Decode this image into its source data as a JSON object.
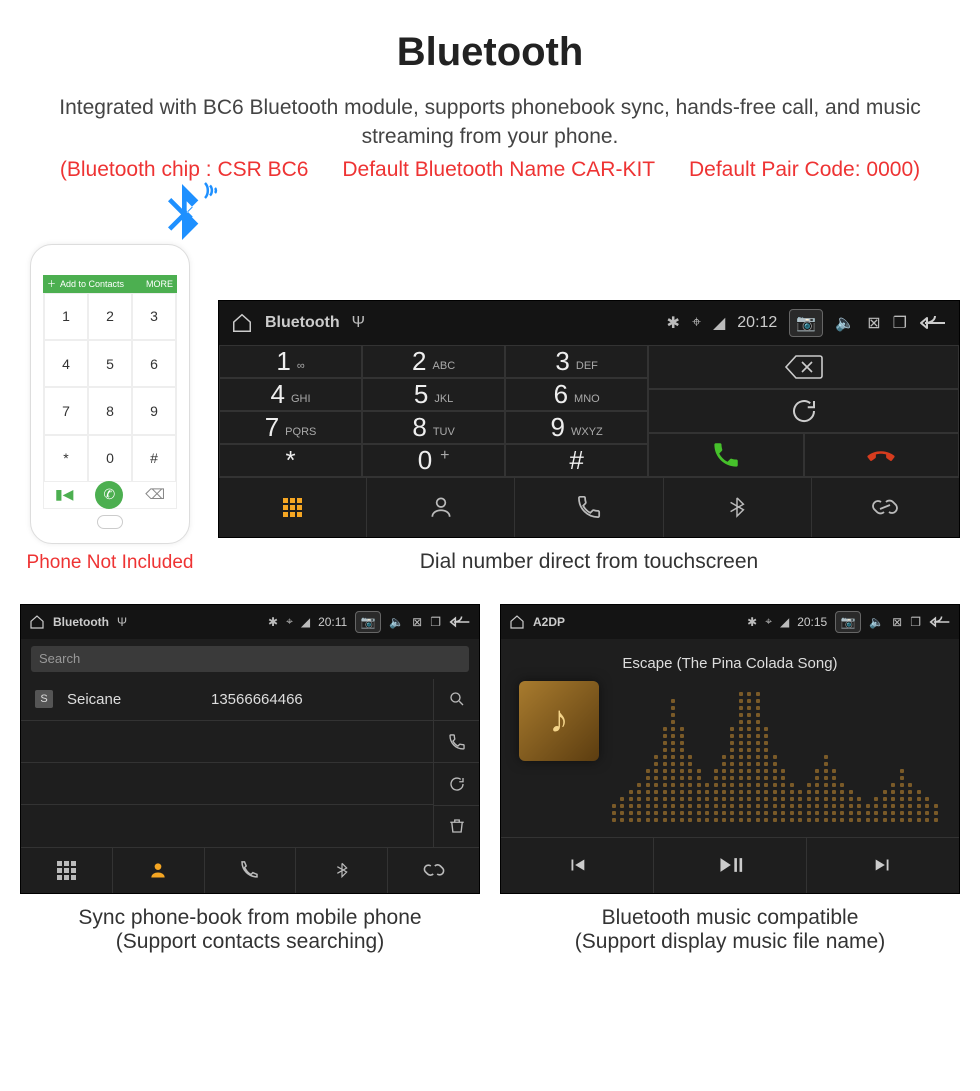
{
  "header": {
    "title": "Bluetooth",
    "description": "Integrated with BC6 Bluetooth module, supports phonebook sync, hands-free call, and music streaming from your phone.",
    "spec_chip": "(Bluetooth chip : CSR BC6",
    "spec_name": "Default Bluetooth Name CAR-KIT",
    "spec_code": "Default Pair Code: 0000)"
  },
  "phone": {
    "topbar_add": "Add to Contacts",
    "topbar_more": "MORE",
    "keys": [
      "1",
      "2",
      "3",
      "4",
      "5",
      "6",
      "7",
      "8",
      "9",
      "*",
      "0",
      "#"
    ],
    "caption": "Phone Not Included"
  },
  "dialer": {
    "statusbar": {
      "title": "Bluetooth",
      "time": "20:12"
    },
    "keys": [
      {
        "d": "1",
        "s": "∞"
      },
      {
        "d": "2",
        "s": "ABC"
      },
      {
        "d": "3",
        "s": "DEF"
      },
      {
        "d": "4",
        "s": "GHI"
      },
      {
        "d": "5",
        "s": "JKL"
      },
      {
        "d": "6",
        "s": "MNO"
      },
      {
        "d": "7",
        "s": "PQRS"
      },
      {
        "d": "8",
        "s": "TUV"
      },
      {
        "d": "9",
        "s": "WXYZ"
      },
      {
        "d": "*",
        "s": ""
      },
      {
        "d": "0",
        "s": "+"
      },
      {
        "d": "#",
        "s": ""
      }
    ],
    "caption": "Dial number direct from touchscreen"
  },
  "phonebook": {
    "statusbar": {
      "title": "Bluetooth",
      "time": "20:11"
    },
    "search_placeholder": "Search",
    "contact": {
      "badge": "S",
      "name": "Seicane",
      "number": "13566664466"
    },
    "caption_line1": "Sync phone-book from mobile phone",
    "caption_line2": "(Support contacts searching)"
  },
  "music": {
    "statusbar": {
      "title": "A2DP",
      "time": "20:15"
    },
    "track": "Escape (The Pina Colada Song)",
    "caption_line1": "Bluetooth music compatible",
    "caption_line2": "(Support display music file name)"
  }
}
